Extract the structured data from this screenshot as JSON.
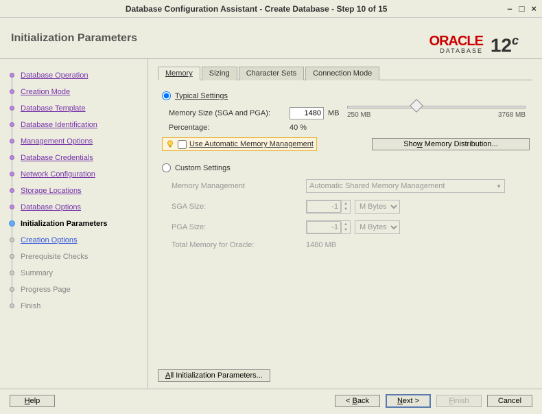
{
  "window": {
    "title": "Database Configuration Assistant - Create Database - Step 10 of 15"
  },
  "header": {
    "title": "Initialization Parameters",
    "brand_main": "ORACLE",
    "brand_sub": "DATABASE",
    "brand_ver": "12",
    "brand_ver_suffix": "c"
  },
  "sidebar": {
    "items": [
      {
        "label": "Database Operation"
      },
      {
        "label": "Creation Mode"
      },
      {
        "label": "Database Template"
      },
      {
        "label": "Database Identification"
      },
      {
        "label": "Management Options"
      },
      {
        "label": "Database Credentials"
      },
      {
        "label": "Network Configuration"
      },
      {
        "label": "Storage Locations"
      },
      {
        "label": "Database Options"
      },
      {
        "label": "Initialization Parameters"
      },
      {
        "label": "Creation Options"
      },
      {
        "label": "Prerequisite Checks"
      },
      {
        "label": "Summary"
      },
      {
        "label": "Progress Page"
      },
      {
        "label": "Finish"
      }
    ]
  },
  "tabs": {
    "memory": "Memory",
    "sizing": "Sizing",
    "charsets": "Character Sets",
    "connmode": "Connection Mode"
  },
  "memory": {
    "typical_label": "Typical Settings",
    "sizelbl": "Memory Size (SGA and PGA):",
    "sizeval": "1480",
    "sizeunit": "MB",
    "pctlbl": "Percentage:",
    "pctval": "40 %",
    "slider_min": "250 MB",
    "slider_max": "3768 MB",
    "amm_label": "Use Automatic Memory Management",
    "show_dist": "Show Memory Distribution...",
    "custom_label": "Custom Settings",
    "memmgmt_lbl": "Memory Management",
    "memmgmt_val": "Automatic Shared Memory Management",
    "sga_lbl": "SGA Size:",
    "sga_val": "-1",
    "pga_lbl": "PGA Size:",
    "pga_val": "-1",
    "unit": "M Bytes",
    "total_lbl": "Total Memory for Oracle:",
    "total_val": "1480 MB",
    "all_params": "All Initialization Parameters..."
  },
  "footer": {
    "help": "Help",
    "back": "< Back",
    "next": "Next >",
    "finish": "Finish",
    "cancel": "Cancel"
  }
}
